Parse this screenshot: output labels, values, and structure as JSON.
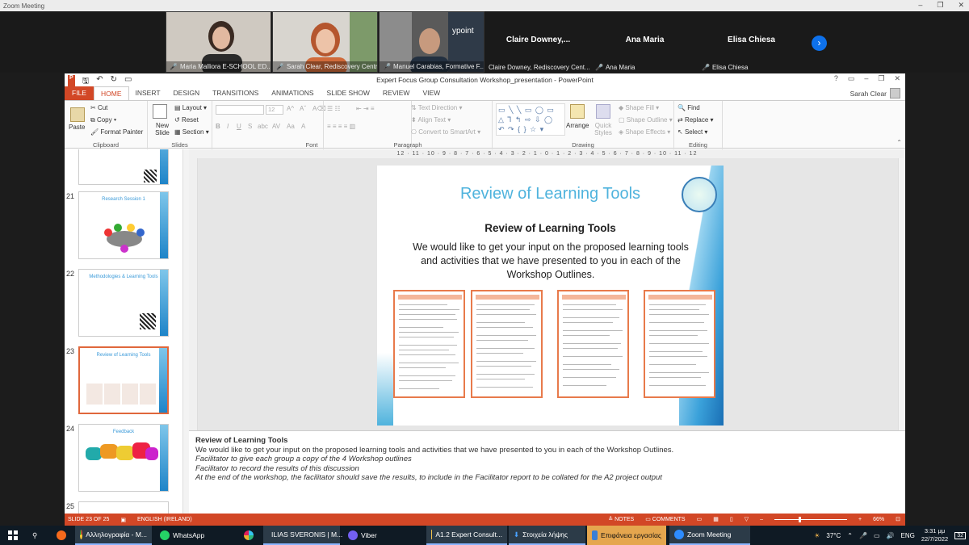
{
  "zoom": {
    "title": "Zoom Meeting",
    "participants_video": [
      {
        "name": "Maria Malliora E-SCHOOL ED..."
      },
      {
        "name": "Sarah Clear, Rediscovery Centre"
      },
      {
        "name": "Manuel Carabias, Formative F..."
      }
    ],
    "participants_tiles": [
      {
        "big": "Claire  Downey,...",
        "name": "Claire Downey, Rediscovery Cent..."
      },
      {
        "big": "Ana Maria",
        "name": "Ana Maria"
      },
      {
        "big": "Elisa Chiesa",
        "name": "Elisa Chiesa"
      }
    ],
    "video_overlay_text": "ypoint"
  },
  "ppt": {
    "window_title": "Expert Focus Group Consultation Workshop_presentation - PowerPoint",
    "user": "Sarah Clear",
    "tabs": [
      "FILE",
      "HOME",
      "INSERT",
      "DESIGN",
      "TRANSITIONS",
      "ANIMATIONS",
      "SLIDE SHOW",
      "REVIEW",
      "VIEW"
    ],
    "ribbon": {
      "clipboard": {
        "paste": "Paste",
        "cut": "Cut",
        "copy": "Copy",
        "format_painter": "Format Painter",
        "label": "Clipboard"
      },
      "slides": {
        "new_slide": "New Slide",
        "layout": "Layout",
        "reset": "Reset",
        "section": "Section",
        "label": "Slides"
      },
      "font": {
        "size": "12",
        "label": "Font"
      },
      "paragraph": {
        "text_direction": "Text Direction",
        "align_text": "Align Text",
        "convert_smartart": "Convert to SmartArt",
        "label": "Paragraph"
      },
      "drawing": {
        "arrange": "Arrange",
        "quick_styles": "Quick Styles",
        "shape_fill": "Shape Fill",
        "shape_outline": "Shape Outline",
        "shape_effects": "Shape Effects",
        "label": "Drawing"
      },
      "editing": {
        "find": "Find",
        "replace": "Replace",
        "select": "Select",
        "label": "Editing"
      }
    },
    "ruler": "12 · 11 · 10 · 9 · 8 · 7 · 6 · 5 · 4 · 3 · 2 · 1 · 0 · 1 · 2 · 3 · 4 · 5 · 6 · 7 · 8 · 9 · 10 · 11 · 12",
    "outline": [
      {
        "num": "21",
        "title": "Research Session 1"
      },
      {
        "num": "22",
        "title": "Methodologies & Learning Tools"
      },
      {
        "num": "23",
        "title": "Review of Learning Tools"
      },
      {
        "num": "24",
        "title": "Feedback"
      },
      {
        "num": "25",
        "title": ""
      }
    ],
    "slide": {
      "title": "Review of Learning Tools",
      "subtitle": "Review of Learning Tools",
      "body": "We would like to get your input on the proposed learning tools and activities that we have presented to you in each of the Workshop Outlines."
    },
    "notes": {
      "heading": "Review of Learning Tools",
      "line1": "We would like to get your input on the proposed learning tools and activities that we have presented to you in each of the Workshop Outlines.",
      "line2": "Facilitator to give each group a copy of the 4 Workshop outlines",
      "line3": "Facilitator to record the results of this discussion",
      "line4": "At the end of the workshop, the facilitator should save the results, to include in the Facilitator report to be collated for the A2 project output"
    },
    "status": {
      "slide": "SLIDE 23 OF 25",
      "language": "ENGLISH (IRELAND)",
      "notes": "NOTES",
      "comments": "COMMENTS",
      "zoom": "66%"
    }
  },
  "taskbar": {
    "items": [
      {
        "label": "Αλληλογραφία - M..."
      },
      {
        "label": "WhatsApp"
      },
      {
        "label": "ILIAS SVERONIS | M..."
      },
      {
        "label": "Viber"
      },
      {
        "label": "A1.2 Expert Consult..."
      },
      {
        "label": "Στοιχεία λήψης"
      },
      {
        "label": "Επιφάνεια εργασίας"
      },
      {
        "label": "Zoom Meeting"
      }
    ],
    "temperature": "37°C",
    "lang": "ENG",
    "time": "3:31 μμ",
    "date": "22/7/2022",
    "notif": "32"
  }
}
